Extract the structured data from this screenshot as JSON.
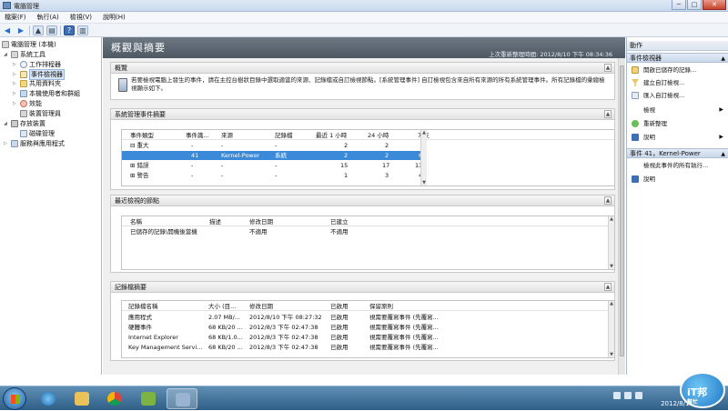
{
  "window": {
    "title": "電腦管理",
    "min": "─",
    "max": "□",
    "close": "✕"
  },
  "menu": [
    "檔案(F)",
    "執行(A)",
    "檢視(V)",
    "說明(H)"
  ],
  "tree": [
    {
      "label": "電腦管理 (本機)",
      "exp": ""
    },
    {
      "label": "系統工具",
      "exp": "◢"
    },
    {
      "label": "工作排程器",
      "exp": "▷"
    },
    {
      "label": "事件檢視器",
      "exp": "▷"
    },
    {
      "label": "共用資料夾",
      "exp": "▷"
    },
    {
      "label": "本機使用者和群組",
      "exp": "▷"
    },
    {
      "label": "效能",
      "exp": "▷"
    },
    {
      "label": "裝置管理員",
      "exp": ""
    },
    {
      "label": "存放裝置",
      "exp": "◢"
    },
    {
      "label": "磁碟管理",
      "exp": ""
    },
    {
      "label": "服務與應用程式",
      "exp": "▷"
    }
  ],
  "center": {
    "title": "概觀與摘要",
    "updated": "上次重新整理時間: 2012/8/10 下午 08:34:36",
    "overview": {
      "title": "概覽",
      "text": "若要檢視電腦上發生的事件，請在主控台樹狀目錄中選取適當的來源、記錄檔或自訂檢視節點。[系統管理事件] 自訂檢視包含來自所有來源的所有系統管理事件。所有記錄檔的彙總檢視顯示如下。"
    },
    "summary": {
      "title": "系統管理事件摘要",
      "headers": [
        "事件類型",
        "事件識...",
        "來源",
        "記錄檔",
        "最近 1 小時",
        "24 小時",
        "7 天"
      ],
      "rows": [
        [
          "⊟ 重大",
          "-",
          "-",
          "-",
          "2",
          "2",
          "6"
        ],
        [
          "",
          "41",
          "Kernel-Power",
          "系統",
          "2",
          "2",
          "6"
        ],
        [
          "⊞ 錯誤",
          "-",
          "-",
          "-",
          "15",
          "17",
          "134"
        ],
        [
          "⊞ 警告",
          "-",
          "-",
          "-",
          "1",
          "3",
          "45"
        ]
      ]
    },
    "recent": {
      "title": "最近檢視的節點",
      "headers": [
        "名稱",
        "描述",
        "修改日期",
        "已建立"
      ],
      "rows": [
        [
          "已儲存的記錄\\開機後當機",
          "",
          "不適用",
          "不適用"
        ]
      ]
    },
    "logsummary": {
      "title": "記錄檔摘要",
      "headers": [
        "記錄檔名稱",
        "大小 (目...",
        "修改日期",
        "已啟用",
        "保留原則"
      ],
      "rows": [
        [
          "應用程式",
          "2.07 MB/...",
          "2012/8/10 下午 08:27:32",
          "已啟用",
          "視需要覆寫事件 (先覆寫..."
        ],
        [
          "硬體事件",
          "68 KB/20 ...",
          "2012/8/3 下午 02:47:38",
          "已啟用",
          "視需要覆寫事件 (先覆寫..."
        ],
        [
          "Internet Explorer",
          "68 KB/1.0...",
          "2012/8/3 下午 02:47:38",
          "已啟用",
          "視需要覆寫事件 (先覆寫..."
        ],
        [
          "Key Management Servi...",
          "68 KB/20 ...",
          "2012/8/3 下午 02:47:38",
          "已啟用",
          "視需要覆寫事件 (先覆寫..."
        ]
      ]
    }
  },
  "actions": {
    "title": "動作",
    "group1": "事件檢視器",
    "items1": [
      "開啟已儲存的記錄...",
      "建立自訂檢視...",
      "匯入自訂檢視...",
      "檢視",
      "重新整理",
      "說明"
    ],
    "group2": "事件 41，Kernel-Power",
    "items2": [
      "檢視此事件的所有執行...",
      "說明"
    ]
  },
  "taskbar": {
    "date": "2012/8/10"
  },
  "logo": {
    "line1": "iT邦",
    "line2": "幫忙"
  },
  "colors": {
    "selection": "#3b8ad9",
    "header": "#4d5863",
    "taskbar": "#2f5f86"
  }
}
